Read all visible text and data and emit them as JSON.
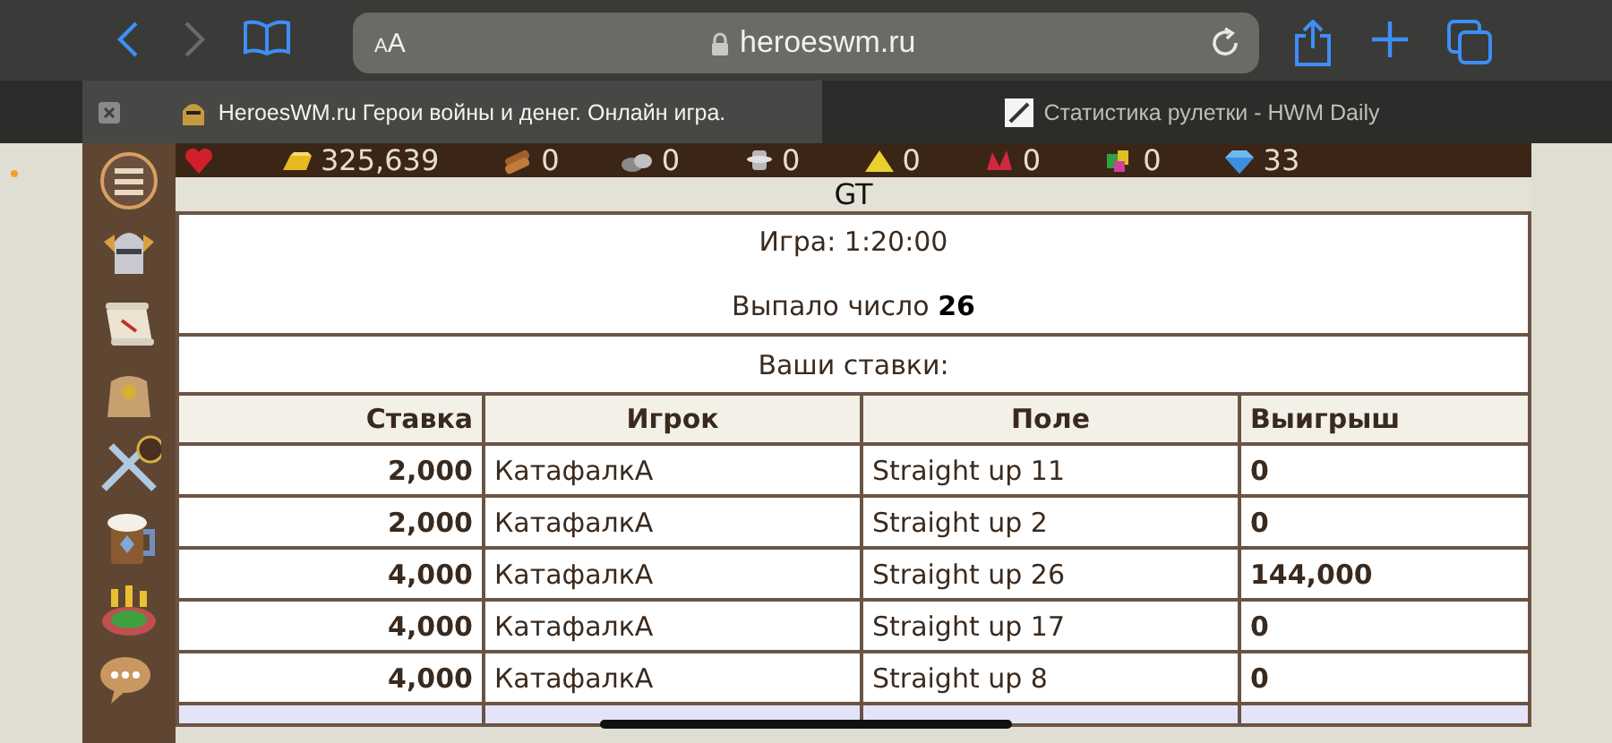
{
  "browser": {
    "text_size_button": "AA",
    "url": "heroeswm.ru"
  },
  "tabs": [
    {
      "title": "HeroesWM.ru Герои войны и денег. Онлайн игра.",
      "selected": true
    },
    {
      "title": "Статистика рулетки - HWM Daily",
      "selected": false
    }
  ],
  "resources": [
    {
      "kind": "heart"
    },
    {
      "kind": "gold",
      "value": "325,639"
    },
    {
      "kind": "wood",
      "value": "0"
    },
    {
      "kind": "ore",
      "value": "0"
    },
    {
      "kind": "mercury",
      "value": "0"
    },
    {
      "kind": "sulfur",
      "value": "0"
    },
    {
      "kind": "crystal",
      "value": "0"
    },
    {
      "kind": "gems",
      "value": "0"
    },
    {
      "kind": "diamond",
      "value": "33"
    }
  ],
  "header": "GT",
  "game": "Игра: 1:20:00",
  "result": "Выпало число **26**",
  "bets_title": "Ваши ставки:",
  "table": {
    "columns": [
      "Ставка",
      "Игрок",
      "Поле",
      "Выигрыш"
    ],
    "rows": [
      [
        "2,000",
        "КатафалкА",
        "Straight up 11",
        "0"
      ],
      [
        "2,000",
        "КатафалкА",
        "Straight up 2",
        "0"
      ],
      [
        "4,000",
        "КатафалкА",
        "Straight up 26",
        "144,000"
      ],
      [
        "4,000",
        "КатафалкА",
        "Straight up 17",
        "0"
      ],
      [
        "4,000",
        "КатафалкА",
        "Straight up 8",
        "0"
      ]
    ]
  }
}
